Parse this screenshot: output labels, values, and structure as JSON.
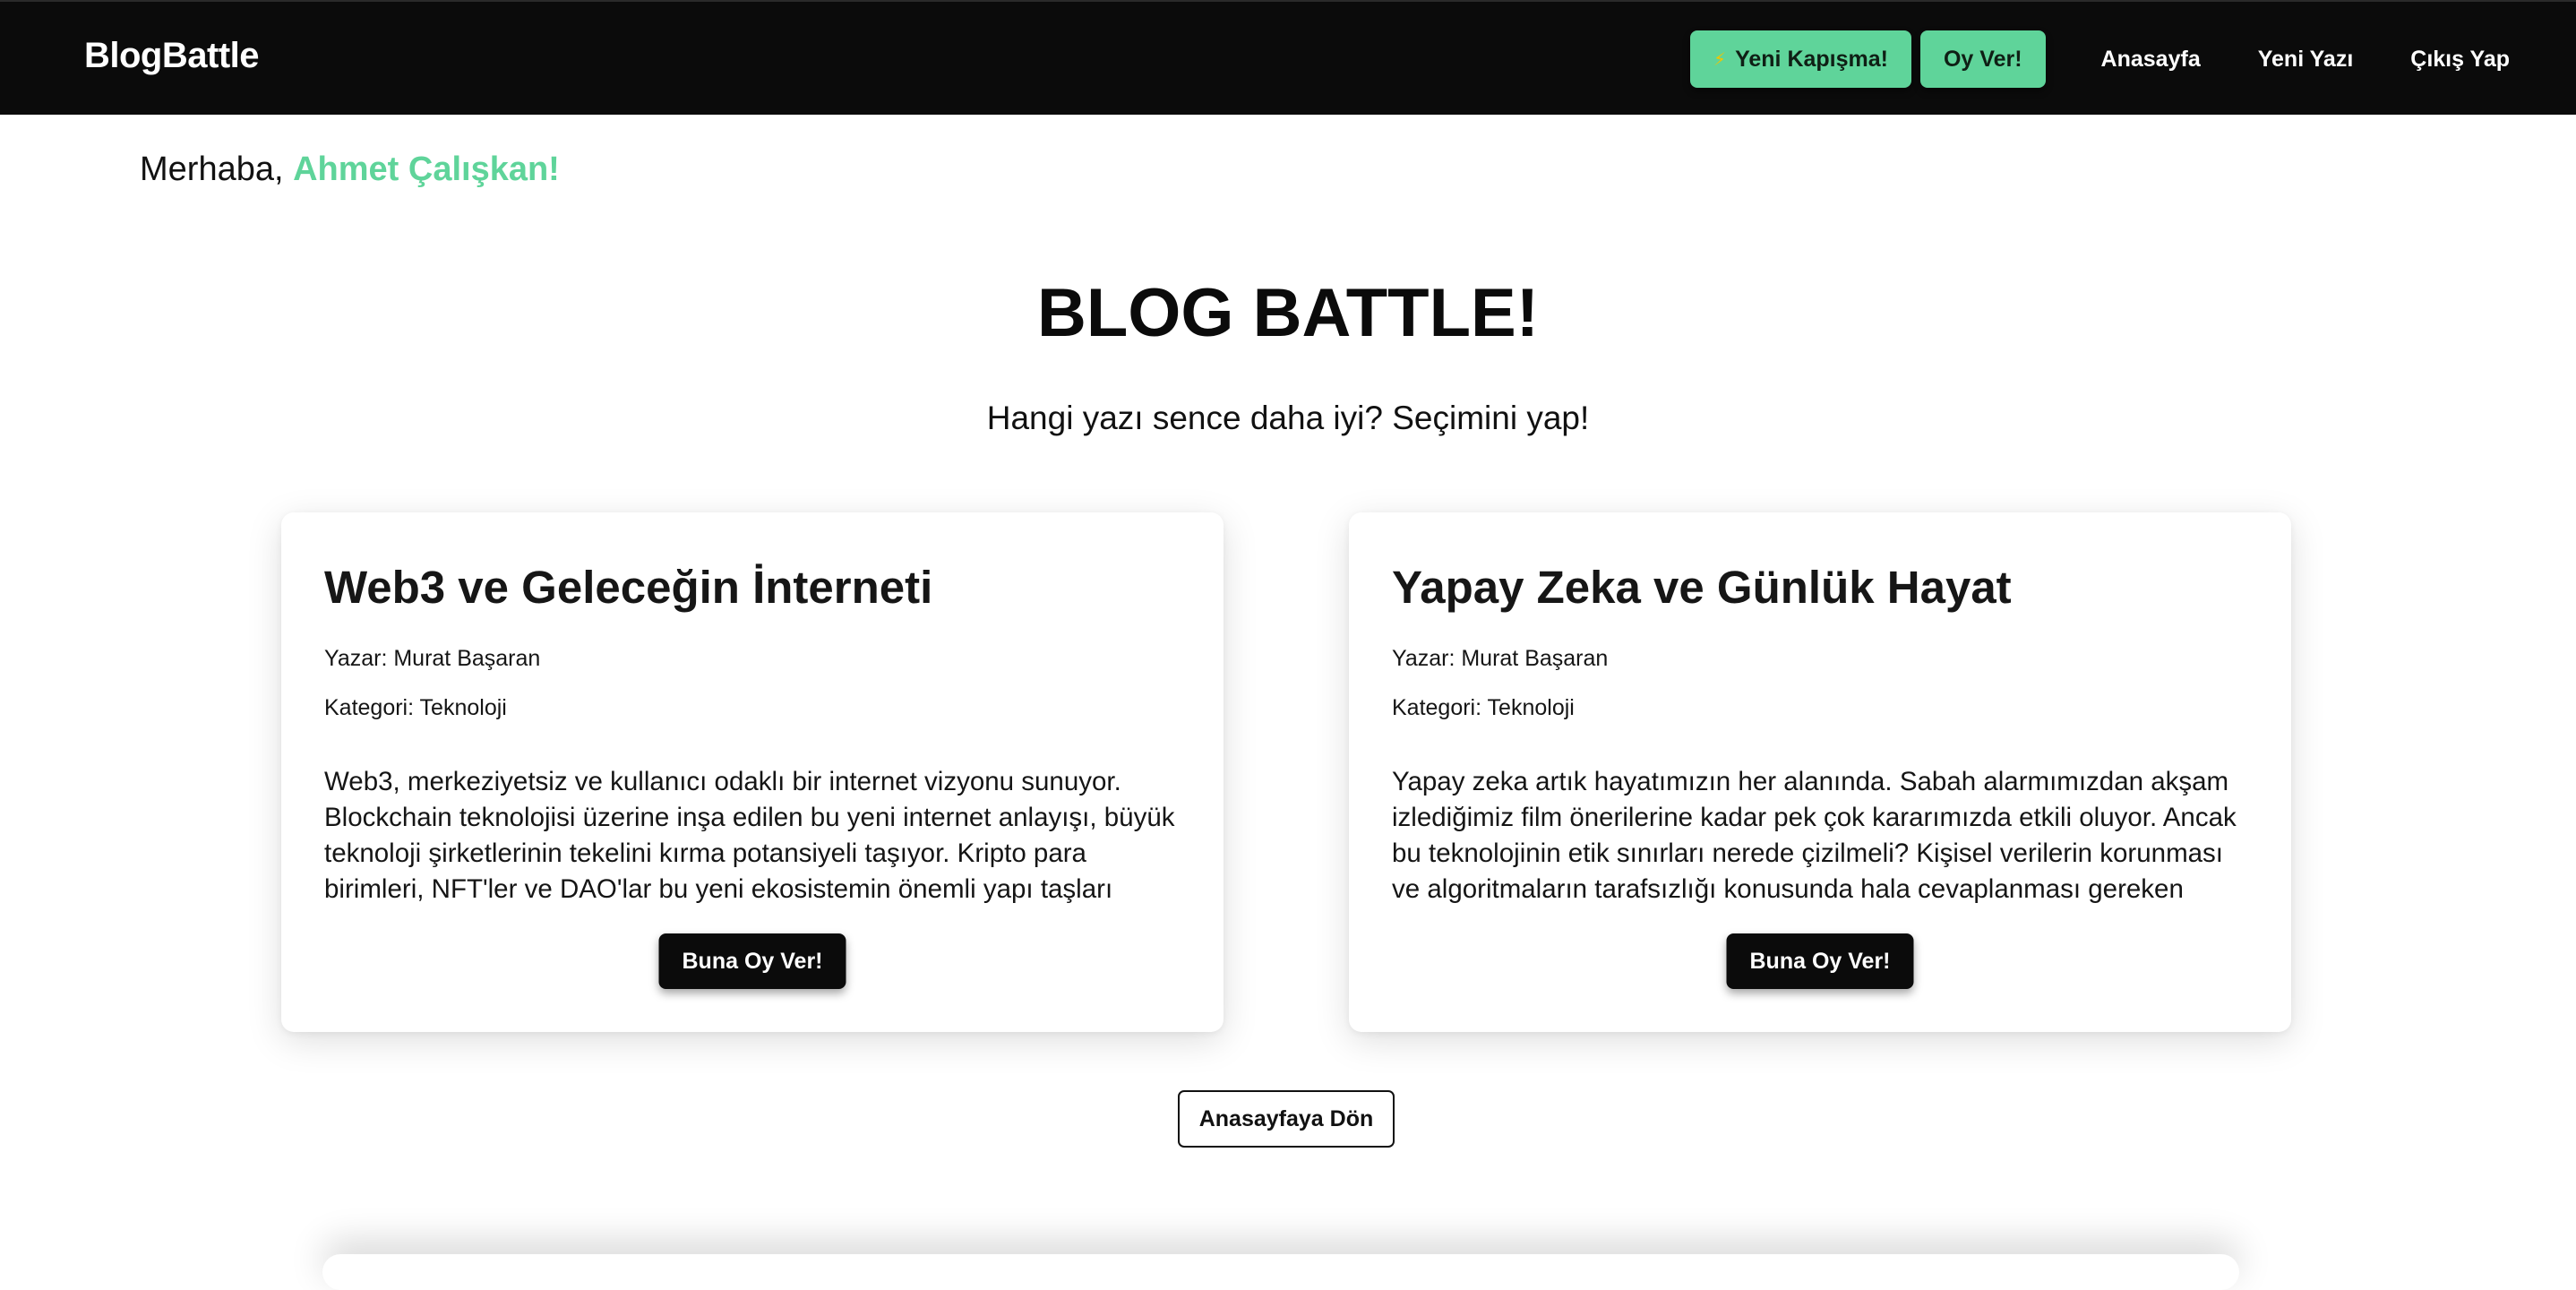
{
  "navbar": {
    "brand": "BlogBattle",
    "new_battle_label": "Yeni Kapışma!",
    "vote_label": "Oy Ver!",
    "links": [
      "Anasayfa",
      "Yeni Yazı",
      "Çıkış Yap"
    ],
    "bolt_icon": "⚡",
    "accent_color": "#5fd49a",
    "background_color": "#0b0b0b"
  },
  "greeting": {
    "prefix": "Merhaba, ",
    "user_name": "Ahmet Çalışkan!"
  },
  "main": {
    "title": "BLOG BATTLE!",
    "subtitle": "Hangi yazı sence daha iyi? Seçimini yap!"
  },
  "posts": [
    {
      "title": "Web3 ve Geleceğin İnterneti",
      "author": "Yazar: Murat Başaran",
      "category": "Kategori: Teknoloji",
      "excerpt": "Web3, merkeziyetsiz ve kullanıcı odaklı bir internet vizyonu sunuyor. Blockchain teknolojisi üzerine inşa edilen bu yeni internet anlayışı, büyük teknoloji şirketlerinin tekelini kırma potansiyeli taşıyor. Kripto para birimleri, NFT'ler ve DAO'lar bu yeni ekosistemin önemli yapı taşları olara...",
      "vote_label": "Buna Oy Ver!"
    },
    {
      "title": "Yapay Zeka ve Günlük Hayat",
      "author": "Yazar: Murat Başaran",
      "category": "Kategori: Teknoloji",
      "excerpt": "Yapay zeka artık hayatımızın her alanında. Sabah alarmımızdan akşam izlediğimiz film önerilerine kadar pek çok kararımızda etkili oluyor. Ancak bu teknolojinin etik sınırları nerede çizilmeli? Kişisel verilerin korunması ve algoritmaların tarafsızlığı konusunda hala cevaplanması gereken sorular...",
      "vote_label": "Buna Oy Ver!"
    }
  ],
  "footer": {
    "home_button_label": "Anasayfaya Dön"
  }
}
